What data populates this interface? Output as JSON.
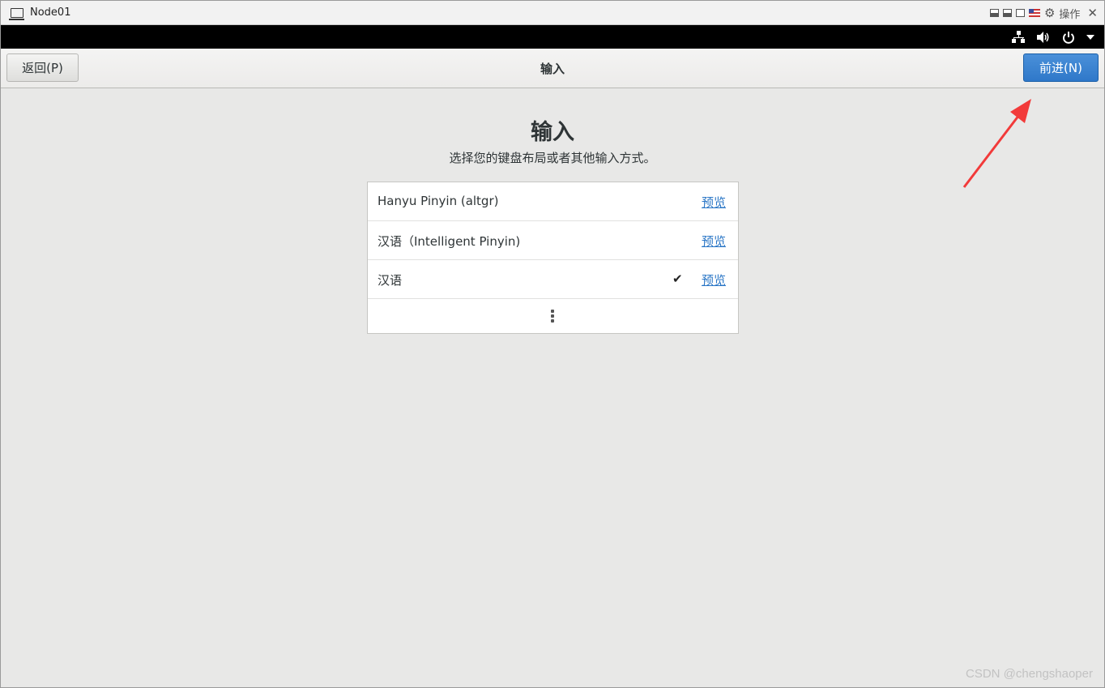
{
  "host_window": {
    "title": "Node01",
    "ops_label": "操作"
  },
  "header": {
    "back_label": "返回(P)",
    "title": "输入",
    "next_label": "前进(N)"
  },
  "main": {
    "title": "输入",
    "subtitle": "选择您的键盘布局或者其他输入方式。"
  },
  "input_sources": [
    {
      "label": "Hanyu Pinyin (altgr)",
      "preview": "预览",
      "selected": false
    },
    {
      "label": "汉语（Intelligent Pinyin)",
      "preview": "预览",
      "selected": false
    },
    {
      "label": "汉语",
      "preview": "预览",
      "selected": true
    }
  ],
  "check_glyph": "✔",
  "watermark": "CSDN @chengshaoper",
  "colors": {
    "accent": "#2f78c9",
    "link": "#2a76c6",
    "annotation_arrow": "#f23a3a"
  }
}
